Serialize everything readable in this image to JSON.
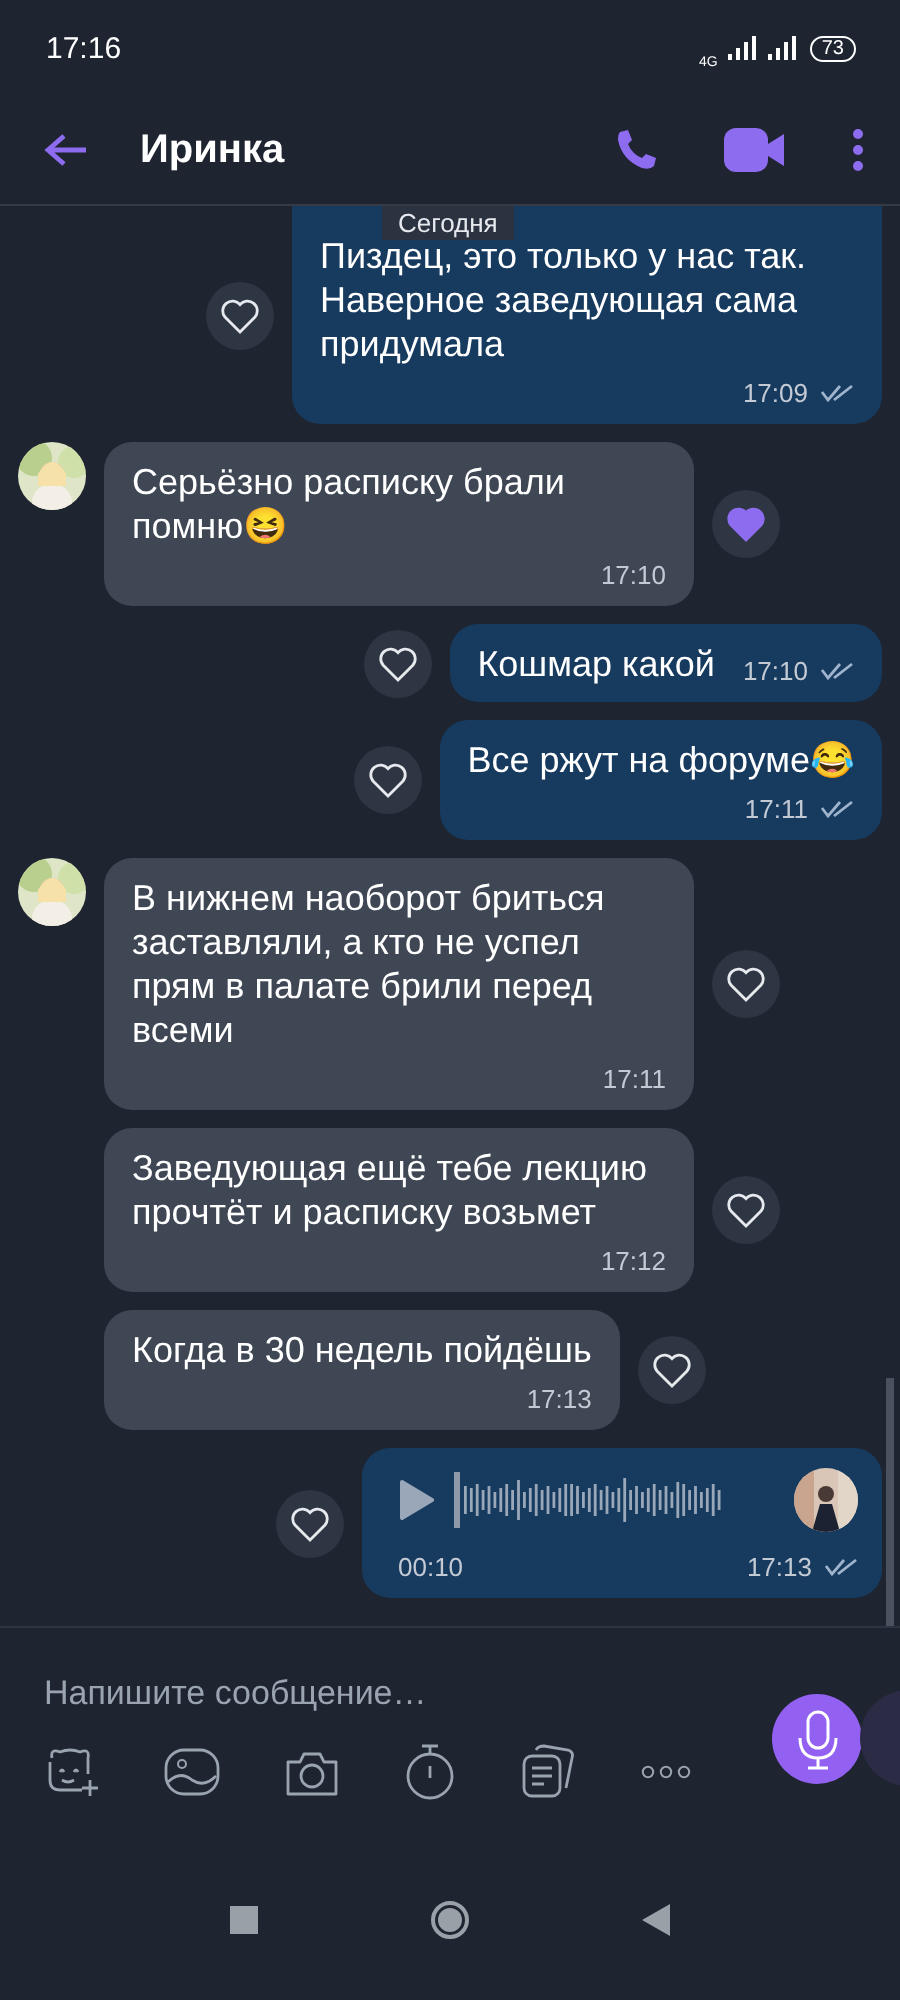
{
  "status_bar": {
    "time": "17:16",
    "network": "4G",
    "battery": "73"
  },
  "header": {
    "title": "Иринка"
  },
  "date_chip": "Сегодня",
  "messages": [
    {
      "kind": "out",
      "text": "Пиздец, это только у нас так. Наверное заведующая сама придумала",
      "time": "17:09",
      "liked": false
    },
    {
      "kind": "in",
      "avatar": true,
      "text": "Серьёзно расписку брали помню😆",
      "time": "17:10",
      "liked": true
    },
    {
      "kind": "out",
      "text": "Кошмар какой",
      "time": "17:10",
      "liked": false,
      "time_inline": true
    },
    {
      "kind": "out",
      "text": "Все ржут на форуме😂",
      "time": "17:11",
      "liked": false
    },
    {
      "kind": "in",
      "avatar": true,
      "text": "В нижнем наоборот бриться заставляли, а кто не успел прям в палате брили перед всеми",
      "time": "17:11",
      "liked": false
    },
    {
      "kind": "in",
      "avatar": false,
      "text": "Заведующая ещё тебе лекцию прочтёт и расписку возьмет",
      "time": "17:12",
      "liked": false
    },
    {
      "kind": "in",
      "avatar": false,
      "text": "Когда в 30 недель пойдёшь",
      "time": "17:13",
      "liked": false
    },
    {
      "kind": "voice",
      "duration": "00:10",
      "time": "17:13",
      "liked": false
    }
  ],
  "composer": {
    "placeholder": "Напишите сообщение…"
  }
}
